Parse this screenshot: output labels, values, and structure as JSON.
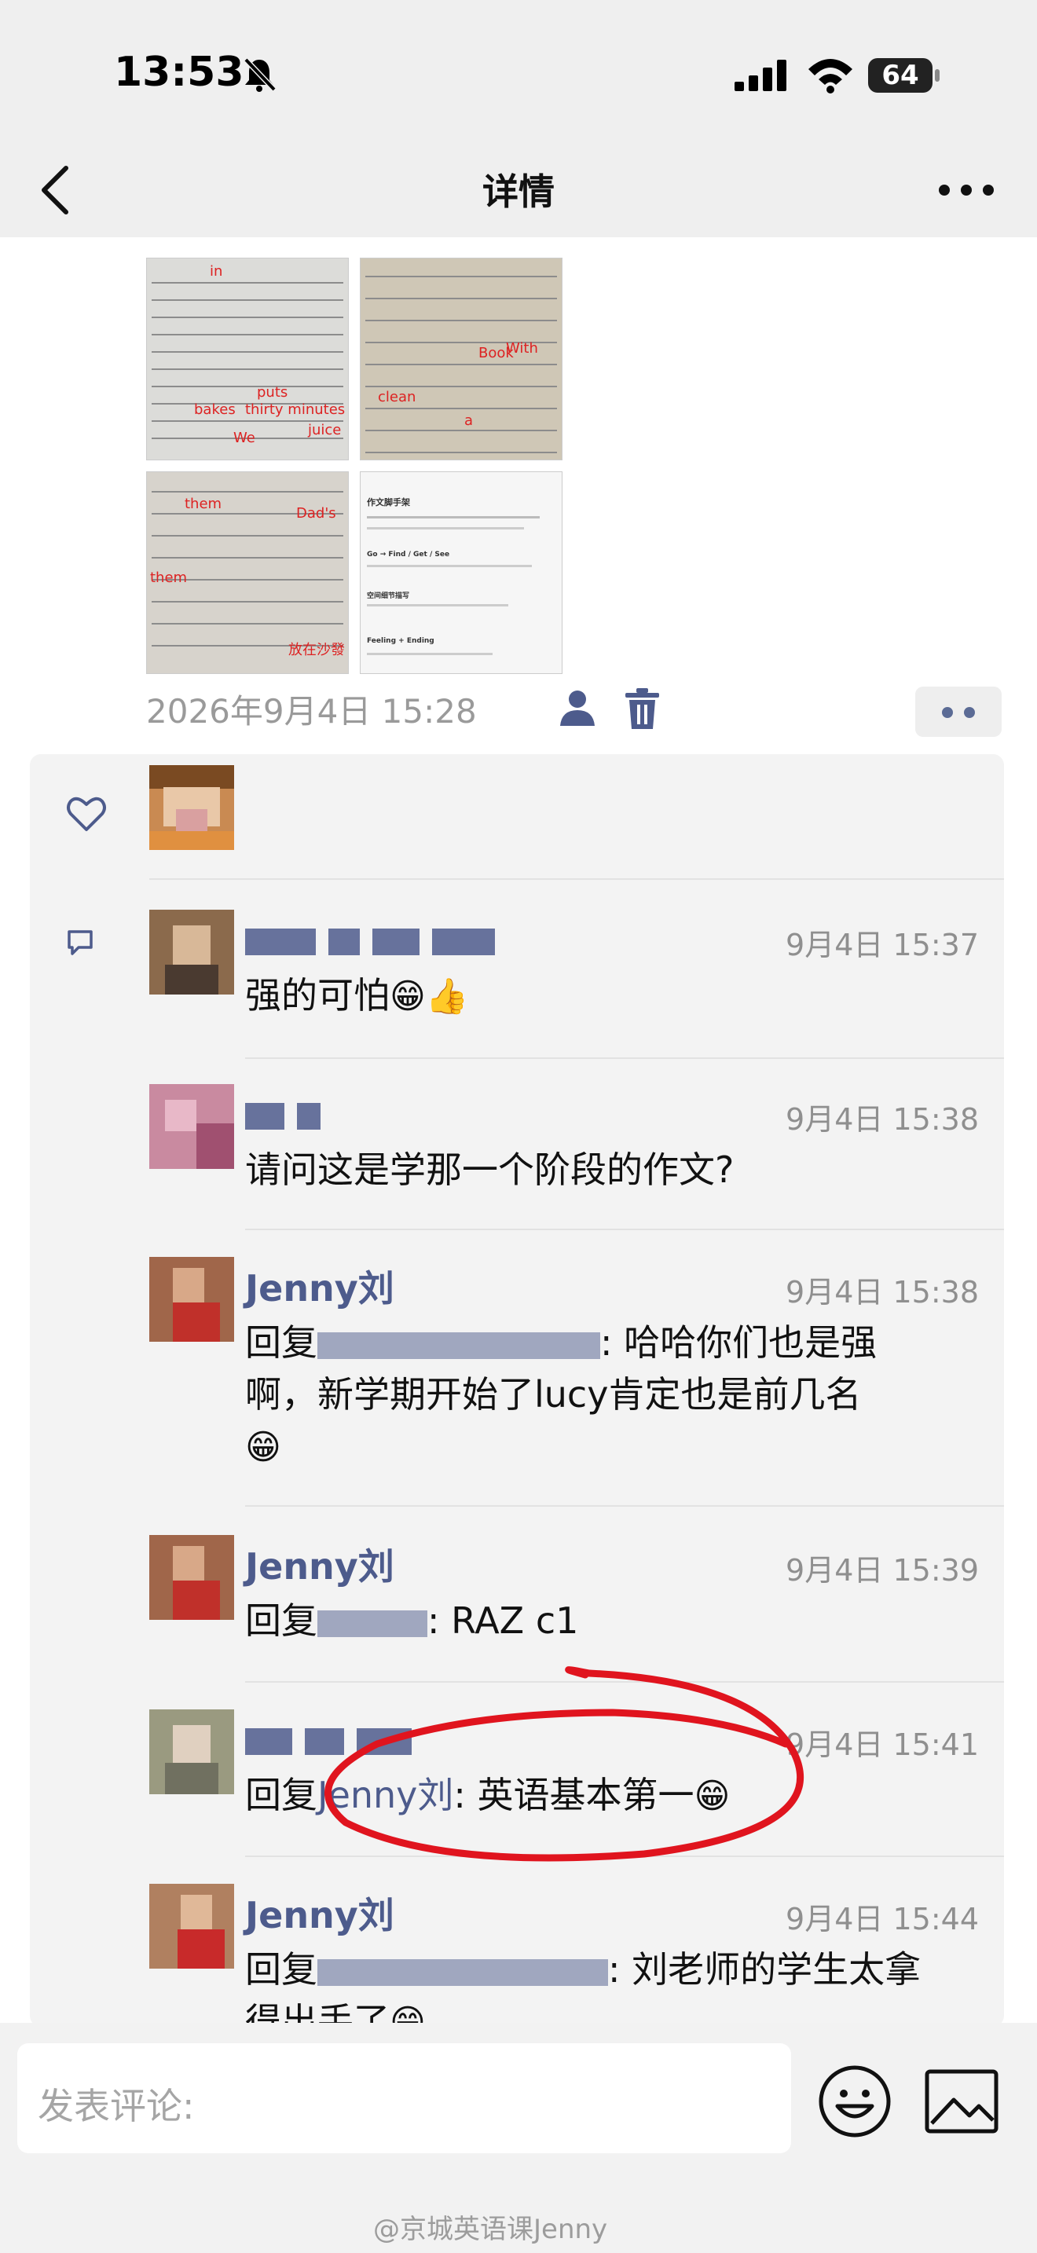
{
  "status_bar": {
    "time": "13:53",
    "battery": "64"
  },
  "nav": {
    "title": "详情"
  },
  "post": {
    "photo_marks": {
      "photo1": [
        "in",
        "puts",
        "bakes",
        "thirty minutes",
        "We",
        "juice"
      ],
      "photo2": [
        "Book",
        "With",
        "clean",
        "a"
      ],
      "photo3": [
        "them",
        "Dad's",
        "them",
        "放在沙發"
      ],
      "photo4": [
        "作文脚手架",
        "Go → Find / Get / See",
        "空间细节描写",
        "Feeling + Ending"
      ]
    },
    "timestamp": "2026年9月4日 15:28"
  },
  "comments": [
    {
      "time": "9月4日 15:37",
      "text": "强的可怕",
      "emoji": "😁👍"
    },
    {
      "time": "9月4日 15:38",
      "text": "请问这是学那一个阶段的作文?"
    },
    {
      "name": "Jenny刘",
      "time": "9月4日 15:38",
      "reply_prefix": "回复",
      "text_line1": ": 哈哈你们也是强",
      "text_line2": "啊，新学期开始了lucy肯定也是前几名",
      "emoji": "😁"
    },
    {
      "name": "Jenny刘",
      "time": "9月4日 15:39",
      "reply_prefix": "回复",
      "text": ": RAZ c1"
    },
    {
      "time": "9月4日 15:41",
      "reply_prefix": "回复",
      "reply_to": "Jenny刘",
      "text": ": 英语基本第一",
      "emoji": "😁"
    },
    {
      "name": "Jenny刘",
      "time": "9月4日 15:44",
      "reply_prefix": "回复",
      "text": ": 刘老师的学生太拿",
      "text_line2": "得出手了",
      "emoji": "😁"
    }
  ],
  "input": {
    "placeholder": "发表评论:"
  },
  "watermark": "@京城英语课Jenny",
  "colors": {
    "name": "#4d5b8c",
    "annotation": "#e0141e"
  }
}
